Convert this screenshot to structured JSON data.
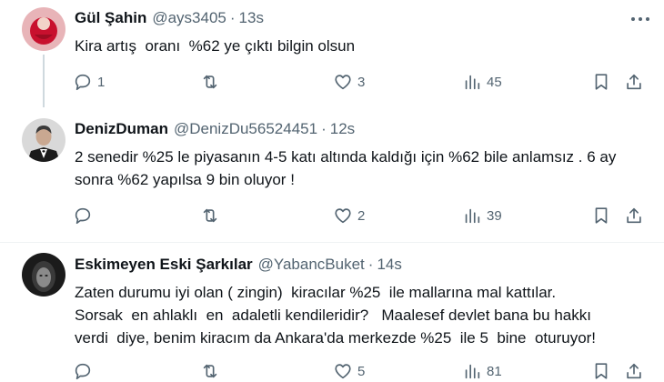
{
  "tweets": [
    {
      "name": "Gül Şahin",
      "handle": "@ays3405",
      "sep": "·",
      "time": "13s",
      "text": "Kira artış  oranı  %62 ye çıktı bilgin olsun",
      "replies": "1",
      "retweets": "",
      "likes": "3",
      "views": "45"
    },
    {
      "name": "DenizDuman",
      "handle": "@DenizDu56524451",
      "sep": "·",
      "time": "12s",
      "text": "2 senedir %25 le piyasanın 4-5 katı altında kaldığı için %62 bile anlamsız . 6 ay sonra %62 yapılsa 9 bin oluyor !",
      "replies": "",
      "retweets": "",
      "likes": "2",
      "views": "39"
    },
    {
      "name": "Eskimeyen Eski Şarkılar",
      "handle": "@YabancBuket",
      "sep": "·",
      "time": "14s",
      "text": "Zaten durumu iyi olan ( zingin)  kiracılar %25  ile mallarına mal kattılar.\nSorsak  en ahlaklı  en  adaletli kendileridir?   Maalesef devlet bana bu hakkı\nverdi  diye, benim kiracım da Ankara'da merkezde %25  ile 5  bine  oturuyor!",
      "replies": "",
      "retweets": "",
      "likes": "5",
      "views": "81"
    }
  ],
  "icons": {
    "reply": "reply-icon",
    "retweet": "retweet-icon",
    "like": "heart-icon",
    "views": "views-icon",
    "bookmark": "bookmark-icon",
    "share": "share-icon",
    "more": "more-icon"
  },
  "colors": {
    "text": "#0f1419",
    "secondary": "#536471",
    "divider": "#eff3f4",
    "thread_line": "#cfd9de"
  }
}
